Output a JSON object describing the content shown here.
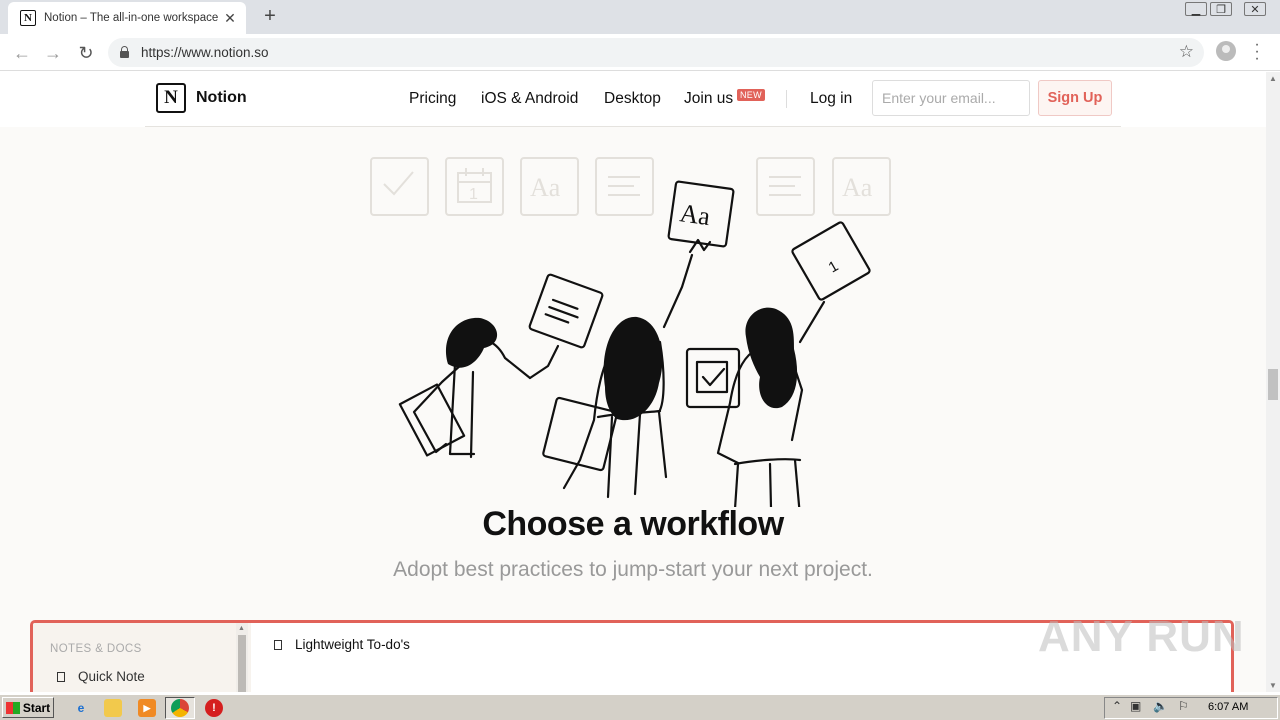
{
  "browser": {
    "tab_title": "Notion – The all-in-one workspace for your notes, tasks, wikis, and databases",
    "tab_favicon": "N",
    "new_tab": "+",
    "url": "https://www.notion.so",
    "icons": {
      "back": "←",
      "forward": "→",
      "reload": "↻",
      "star": "☆",
      "close": "✕",
      "menu": "⋮"
    }
  },
  "nav": {
    "logo_glyph": "N",
    "brand": "Notion",
    "links": [
      "Pricing",
      "iOS & Android",
      "Desktop",
      "Join us"
    ],
    "badge": "NEW",
    "login": "Log in",
    "email_placeholder": "Enter your email...",
    "signup": "Sign Up"
  },
  "hero": {
    "card_aa": "Aa",
    "card_day": "1",
    "headline": "Choose a workflow",
    "subline": "Adopt best practices to jump-start your next project."
  },
  "workflow": {
    "section": "NOTES & DOCS",
    "sidebar_item": "Quick Note",
    "todo": "Lightweight To-do's"
  },
  "watermark": "ANY RUN",
  "taskbar": {
    "start": "Start",
    "clock": "6:07 AM"
  },
  "colors": {
    "accent": "#e16259",
    "page_bg": "#fbfaf8",
    "ink": "#111111"
  }
}
